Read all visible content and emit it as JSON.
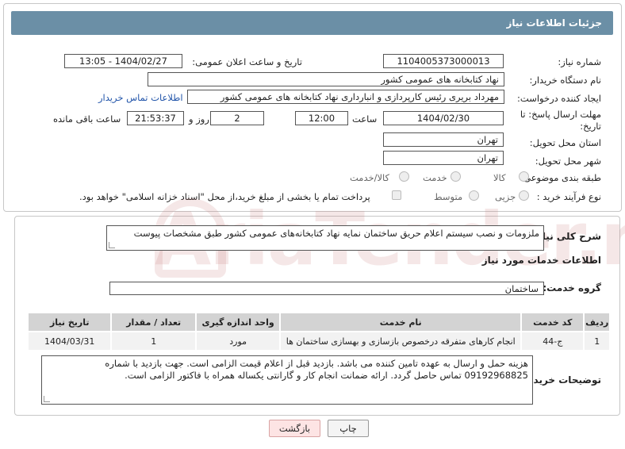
{
  "header": {
    "title": "جزئیات اطلاعات نیاز"
  },
  "fields": {
    "need_number": {
      "label": "شماره نیاز:",
      "value": "1104005373000013"
    },
    "announce_datetime": {
      "label": "تاریخ و ساعت اعلان عمومی:",
      "value": "1404/02/27 - 13:05"
    },
    "buyer_org": {
      "label": "نام دستگاه خریدار:",
      "value": "نهاد کتابخانه های عمومی کشور"
    },
    "requester": {
      "label": "ایجاد کننده درخواست:",
      "value": "مهرداد بریری رئیس کارپردازی و انبارداری نهاد کتابخانه های عمومی کشور",
      "link": "اطلاعات تماس خریدار"
    },
    "deadline": {
      "label": "مهلت ارسال پاسخ: تا تاریخ:",
      "date": "1404/02/30",
      "time_label": "ساعت",
      "time": "12:00",
      "days": "2",
      "days_label": "روز و",
      "remaining": "21:53:37",
      "remaining_label": "ساعت باقی مانده"
    },
    "province": {
      "label": "استان محل تحویل:",
      "value": "تهران"
    },
    "city": {
      "label": "شهر محل تحویل:",
      "value": "تهران"
    },
    "category": {
      "label": "طبقه بندی موضوعی:",
      "options": [
        "کالا",
        "خدمت",
        "کالا/خدمت"
      ]
    },
    "process": {
      "label": "نوع فرآیند خرید :",
      "options": [
        "جزیی",
        "متوسط"
      ],
      "note": "پرداخت تمام یا بخشی از مبلغ خرید،از محل \"اسناد خزانه اسلامی\" خواهد بود."
    }
  },
  "summary": {
    "label": "شرح کلی نیاز:",
    "value": "ملزومات و نصب سیستم  اعلام حریق ساختمان نمایه نهاد کتابخانه‌های عمومی کشور طبق مشخصات پیوست"
  },
  "services": {
    "section_title": "اطلاعات خدمات مورد نیاز",
    "group_label": "گروه خدمت:",
    "group_value": "ساختمان",
    "columns": [
      "ردیف",
      "کد خدمت",
      "نام خدمت",
      "واحد اندازه گیری",
      "تعداد / مقدار",
      "تاریخ نیاز"
    ],
    "rows": [
      [
        "1",
        "ج-44",
        "انجام کارهای متفرقه درخصوص بازسازی و بهسازی ساختمان ها",
        "مورد",
        "1",
        "1404/03/31"
      ]
    ]
  },
  "buyer_notes": {
    "label": "توضیحات خریدار:",
    "line1": "هزینه حمل و ارسال به عهده تامین کننده می باشد. بازدید قبل از اعلام قیمت الزامی است. جهت بازدید با شماره",
    "line2": "09192968825 تماس حاصل گردد. ارائه ضمانت انجام کار و گارانتی یکساله همراه با فاکتور الزامی است."
  },
  "buttons": {
    "print": "چاپ",
    "back": "بازگشت"
  },
  "watermark": "AriaTender.neT",
  "colors": {
    "header": "#6b8fa6",
    "link": "#2255aa",
    "back_button": "#fde4e4"
  }
}
